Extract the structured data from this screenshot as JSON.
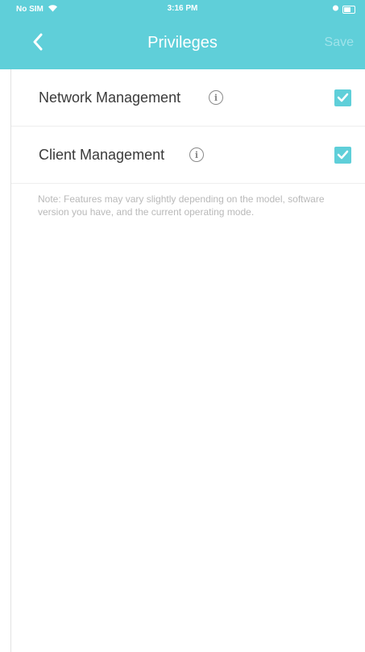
{
  "status_bar": {
    "carrier": "No SIM",
    "time": "3:16 PM"
  },
  "navbar": {
    "title": "Privileges",
    "save_label": "Save"
  },
  "privileges": [
    {
      "label": "Network Management",
      "checked": true
    },
    {
      "label": "Client Management",
      "checked": true
    }
  ],
  "note": "Note: Features may vary slightly depending on the model, software version you have, and the current operating mode.",
  "colors": {
    "accent": "#5fcfd9",
    "text": "#3a3a3a",
    "note": "#b9b9b9"
  },
  "icons": {
    "back": "chevron-left-icon",
    "info": "info-icon",
    "check": "check-icon",
    "wifi": "wifi-icon",
    "battery": "battery-icon",
    "charging": "charging-icon"
  }
}
